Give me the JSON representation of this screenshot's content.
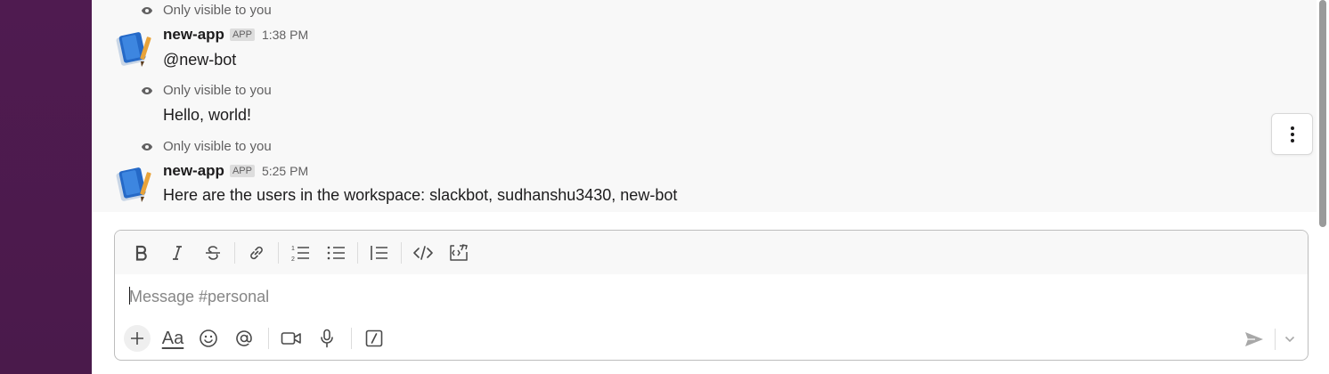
{
  "messages": [
    {
      "kind": "ephemeral",
      "text": "Only visible to you"
    },
    {
      "kind": "message",
      "sender": "new-app",
      "badge": "APP",
      "time": "1:38 PM",
      "text": "@new-bot"
    },
    {
      "kind": "ephemeral",
      "text": "Only visible to you"
    },
    {
      "kind": "message-continued",
      "text": "Hello, world!"
    },
    {
      "kind": "ephemeral",
      "text": "Only visible to you"
    },
    {
      "kind": "message",
      "sender": "new-app",
      "badge": "APP",
      "time": "5:25 PM",
      "text": "Here are the users in the workspace: slackbot, sudhanshu3430, new-bot"
    }
  ],
  "composer": {
    "placeholder": "Message #personal",
    "formatting_tools": [
      "bold-icon",
      "italic-icon",
      "strikethrough-icon",
      "link-icon",
      "ordered-list-icon",
      "bulleted-list-icon",
      "blockquote-icon",
      "code-icon",
      "code-block-icon"
    ],
    "bottom_tools": [
      "plus-icon",
      "text-format-icon",
      "emoji-icon",
      "mention-icon",
      "video-icon",
      "microphone-icon",
      "slash-command-icon"
    ],
    "text_format_label": "Aa"
  },
  "colors": {
    "sidebar": "#4a154b",
    "feed_background": "#f8f8f8",
    "text": "#1d1c1d",
    "muted": "#616061"
  }
}
